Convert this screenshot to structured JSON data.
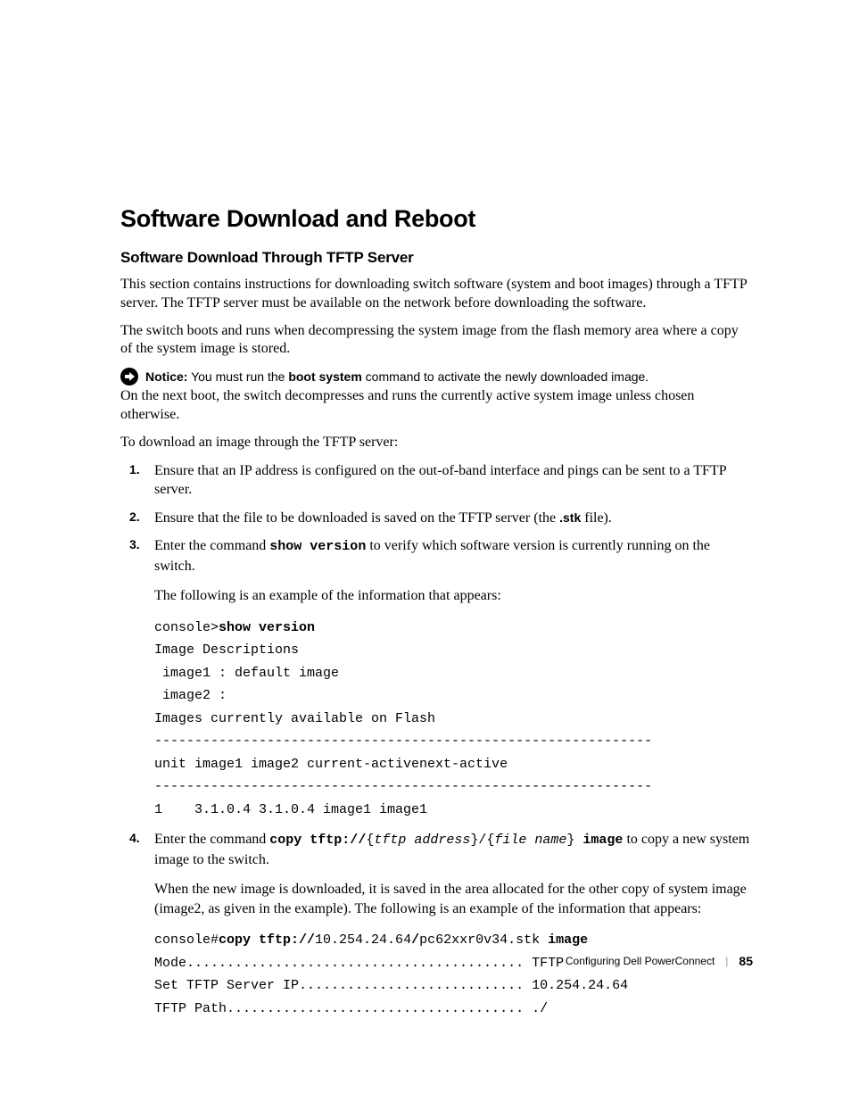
{
  "heading": "Software Download and Reboot",
  "subheading": "Software Download Through TFTP Server",
  "p1": "This section contains instructions for downloading switch software (system and boot images) through a TFTP server. The TFTP server must be available on the network before downloading the software.",
  "p2": "The switch boots and runs when decompressing the system image from the flash memory area where a copy of the system image is stored.",
  "notice": {
    "label": "Notice:",
    "pre": " You must run the ",
    "bold": "boot system",
    "post": " command to activate the newly downloaded image."
  },
  "p3": "On the next boot, the switch decompresses and runs the currently active system image unless chosen otherwise.",
  "p4": "To download an image through the TFTP server:",
  "steps": {
    "s1": "Ensure that an IP address is configured on the out-of-band interface and pings can be sent to a TFTP server.",
    "s2a": "Ensure that the file to be downloaded is saved on the TFTP server (the ",
    "s2b": ".stk",
    "s2c": " file).",
    "s3a": "Enter the command ",
    "s3cmd": "show version",
    "s3b": " to verify which software version is currently running on the switch.",
    "s3sub": "The following is an example of the information that appears:",
    "s4a": "Enter the command ",
    "s4cmd_pre": "copy tftp://",
    "s4brace1": "{",
    "s4arg1": "tftp address",
    "s4brace2": "}/{",
    "s4arg2": "file name",
    "s4brace3": "}",
    "s4cmd_post": " image",
    "s4b": " to copy a new system image to the switch.",
    "s4sub": "When the new image is downloaded, it is saved in the area allocated for the other copy of system image (image2, as given in the example). The following is an example of the information that appears:"
  },
  "code1": {
    "l1a": "console>",
    "l1b": "show version",
    "l2": "Image Descriptions",
    "l3": " image1 : default image",
    "l4": " image2 :",
    "l5": "Images currently available on Flash",
    "l6": "--------------------------------------------------------------",
    "l7": "unit image1 image2 current-activenext-active",
    "l8": "--------------------------------------------------------------",
    "l9": "1    3.1.0.4 3.1.0.4 image1 image1"
  },
  "code2": {
    "l1a": "console#",
    "l1b": "copy tftp://",
    "l1c": "10.254.24.64",
    "l1d": "/",
    "l1e": "pc62xxr0v34.stk ",
    "l1f": "image",
    "l2": "Mode.......................................... TFTP",
    "l3": "Set TFTP Server IP............................ 10.254.24.64",
    "l4": "TFTP Path..................................... ./"
  },
  "footer": {
    "section": "Configuring Dell PowerConnect",
    "page": "85"
  }
}
